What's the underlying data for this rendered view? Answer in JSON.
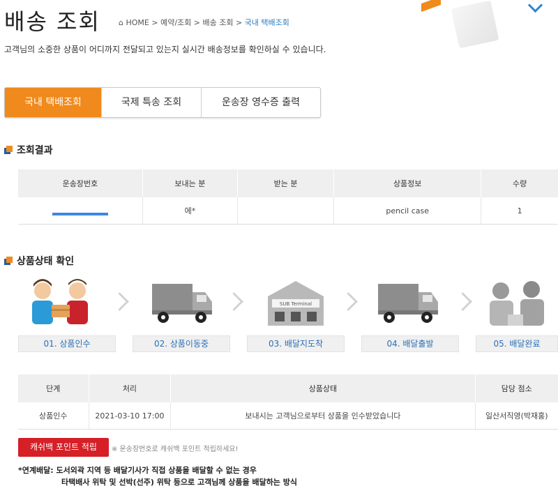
{
  "header": {
    "title": "배송 조회",
    "breadcrumb": {
      "home_icon": "home-icon",
      "home": "HOME",
      "items": [
        "예약/조회",
        "배송 조회"
      ],
      "current": "국내 택배조회",
      "separator": ">"
    },
    "subtitle": "고객님의 소중한 상품이 어디까지 전달되고 있는지 실시간 배송정보를 확인하실 수 있습니다."
  },
  "tabs": [
    {
      "label": "국내 택배조회",
      "active": true
    },
    {
      "label": "국제 특송 조회",
      "active": false
    },
    {
      "label": "운송장 영수증 출력",
      "active": false
    }
  ],
  "result_section": {
    "heading": "조회결과",
    "columns": [
      "운송장번호",
      "보내는 분",
      "받는 분",
      "상품정보",
      "수량"
    ],
    "row": {
      "tracking_no": "",
      "sender": "에*",
      "receiver": "",
      "product": "pencil case",
      "quantity": "1"
    }
  },
  "status_section": {
    "heading": "상품상태 확인",
    "steps": [
      {
        "label": "01. 상품인수",
        "icon": "handover-icon"
      },
      {
        "label": "02. 상품이동중",
        "icon": "truck-icon"
      },
      {
        "label": "03. 배달지도착",
        "icon": "terminal-icon",
        "sign": "SUB Terminal"
      },
      {
        "label": "04. 배달출발",
        "icon": "truck-icon"
      },
      {
        "label": "05. 배달완료",
        "icon": "delivered-icon"
      }
    ],
    "columns": [
      "단계",
      "처리",
      "상품상태",
      "담당 점소"
    ],
    "rows": [
      {
        "stage": "상품인수",
        "time": "2021-03-10 17:00",
        "status": "보내시는 고객님으로부터 상품을 인수받았습니다",
        "branch": "일산서직영(박재홍)"
      }
    ]
  },
  "cashback": {
    "button": "캐쉬백 포인트 적립",
    "note": "※ 운송장번호로 캐쉬백 포인트 적립하세요!"
  },
  "footnote": {
    "line1": "*연계배달: 도서외곽 지역 등 배달기사가 직접 상품을 배달할 수 없는 경우",
    "line2": "타택배사 위탁 및 선박(선주) 위탁 등으로 고객님께 상품을 배달하는 방식"
  },
  "colors": {
    "accent": "#f08a1c",
    "link": "#2a6fb6",
    "cashback": "#d61f26",
    "section_blue": "#1e5fa8"
  }
}
